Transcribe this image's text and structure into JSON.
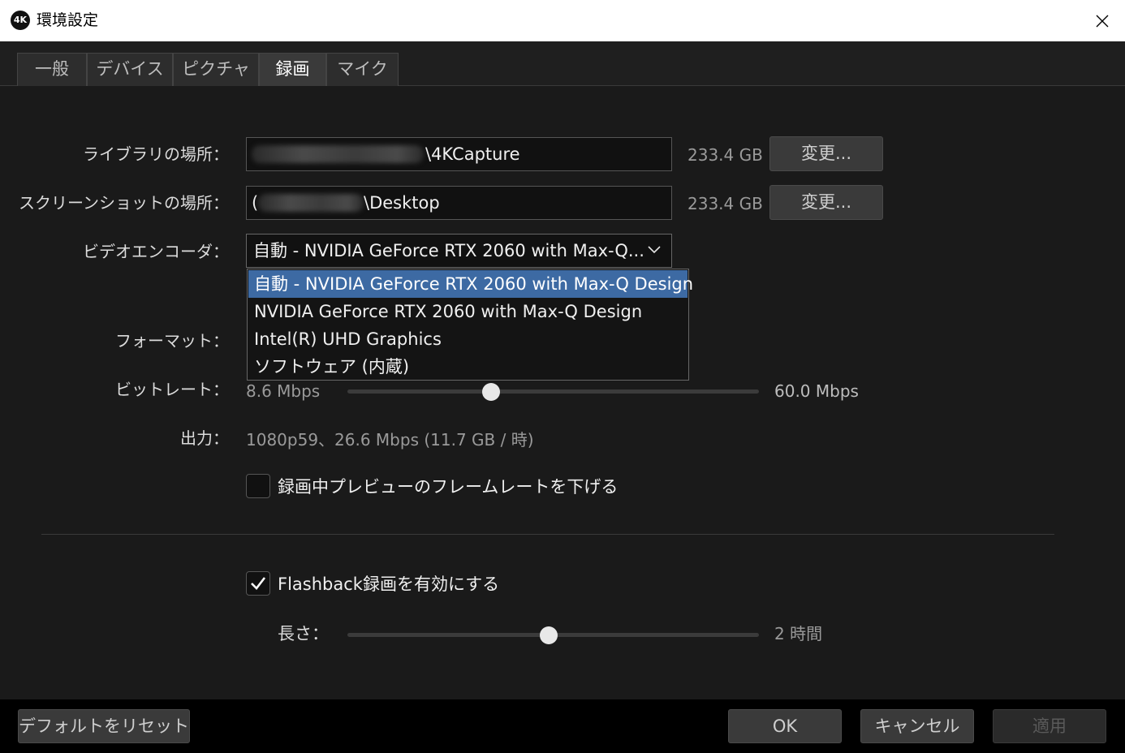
{
  "window": {
    "logo_text": "4K",
    "title": "環境設定"
  },
  "tabs": [
    {
      "label": "一般",
      "active": false
    },
    {
      "label": "デバイス",
      "active": false
    },
    {
      "label": "ピクチャ",
      "active": false
    },
    {
      "label": "録画",
      "active": true
    },
    {
      "label": "マイク",
      "active": false
    }
  ],
  "library": {
    "label": "ライブラリの場所：",
    "path_suffix": "\\4KCapture",
    "free_space": "233.4 GB",
    "change_label": "変更..."
  },
  "screenshot": {
    "label": "スクリーンショットの場所：",
    "path_prefix": "(",
    "path_suffix": "\\Desktop",
    "free_space": "233.4 GB",
    "change_label": "変更..."
  },
  "encoder": {
    "label": "ビデオエンコーダ：",
    "selected": "自動 - NVIDIA GeForce RTX 2060 with Max-Q...",
    "options": [
      "自動 - NVIDIA GeForce RTX 2060 with Max-Q Design",
      "NVIDIA GeForce RTX 2060 with Max-Q Design",
      "Intel(R) UHD Graphics",
      "ソフトウェア (内蔵)"
    ]
  },
  "format": {
    "label": "フォーマット："
  },
  "bitrate": {
    "label": "ビットレート：",
    "min": "8.6 Mbps",
    "max": "60.0 Mbps",
    "position": 0.35
  },
  "output": {
    "label": "出力：",
    "value": "1080p59、26.6 Mbps (11.7 GB / 時)"
  },
  "lower_preview": {
    "label": "録画中プレビューのフレームレートを下げる",
    "checked": false
  },
  "flashback": {
    "label": "Flashback録画を有効にする",
    "checked": true,
    "length_label": "長さ：",
    "length_value": "2 時間",
    "position": 0.49
  },
  "footer": {
    "reset_label": "デフォルトをリセット",
    "ok_label": "OK",
    "cancel_label": "キャンセル",
    "apply_label": "適用"
  },
  "colors": {
    "highlight": "#3d6aa3",
    "background": "#1a1a1a"
  },
  "icons": {
    "close": "close-icon",
    "chevron": "chevron-down-icon",
    "check": "checkmark-icon"
  }
}
